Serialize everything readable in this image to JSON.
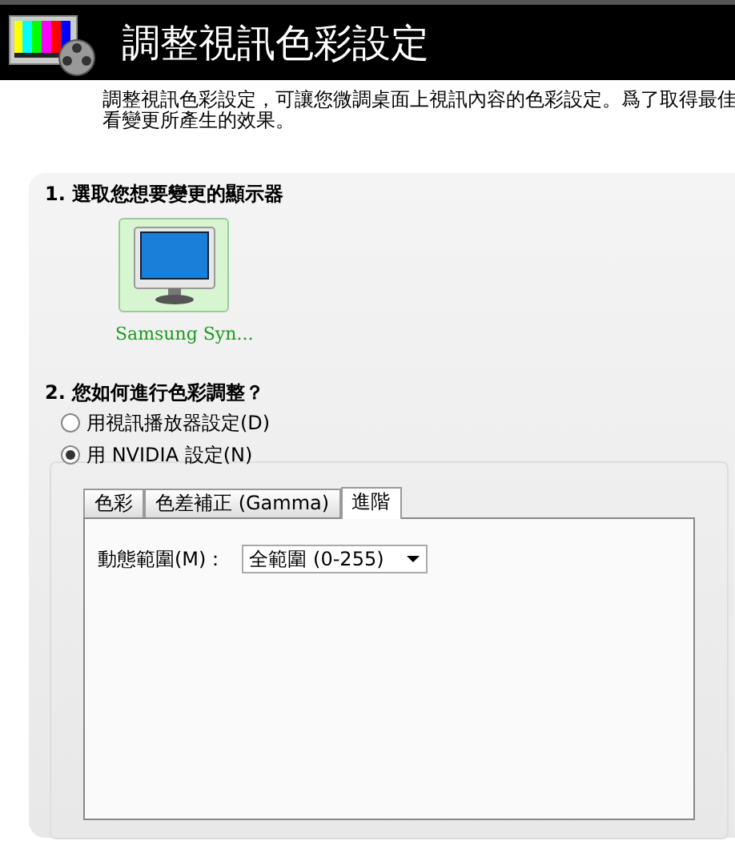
{
  "header": {
    "title": "調整視訊色彩設定"
  },
  "description_lines": [
    "調整視訊色彩設定，可讓您微調桌面上視訊內容的色彩設定。爲了取得最佳",
    "看變更所產生的效果。"
  ],
  "section_1": {
    "heading": "1. 選取您想要變更的顯示器",
    "displays": [
      {
        "label": "Samsung Syn...",
        "selected": true
      }
    ]
  },
  "section_2": {
    "heading": "2. 您如何進行色彩調整？",
    "options": [
      {
        "label": "用視訊播放器設定(D)",
        "selected": false
      },
      {
        "label": "用 NVIDIA 設定(N)",
        "selected": true
      }
    ],
    "tabs": [
      {
        "label": "色彩",
        "selected": false
      },
      {
        "label": "色差補正 (Gamma)",
        "selected": false
      },
      {
        "label": "進階",
        "selected": true
      }
    ],
    "dynamic_range": {
      "label": "動態範圍(M)：",
      "value": "全範圍 (0-255)"
    }
  }
}
